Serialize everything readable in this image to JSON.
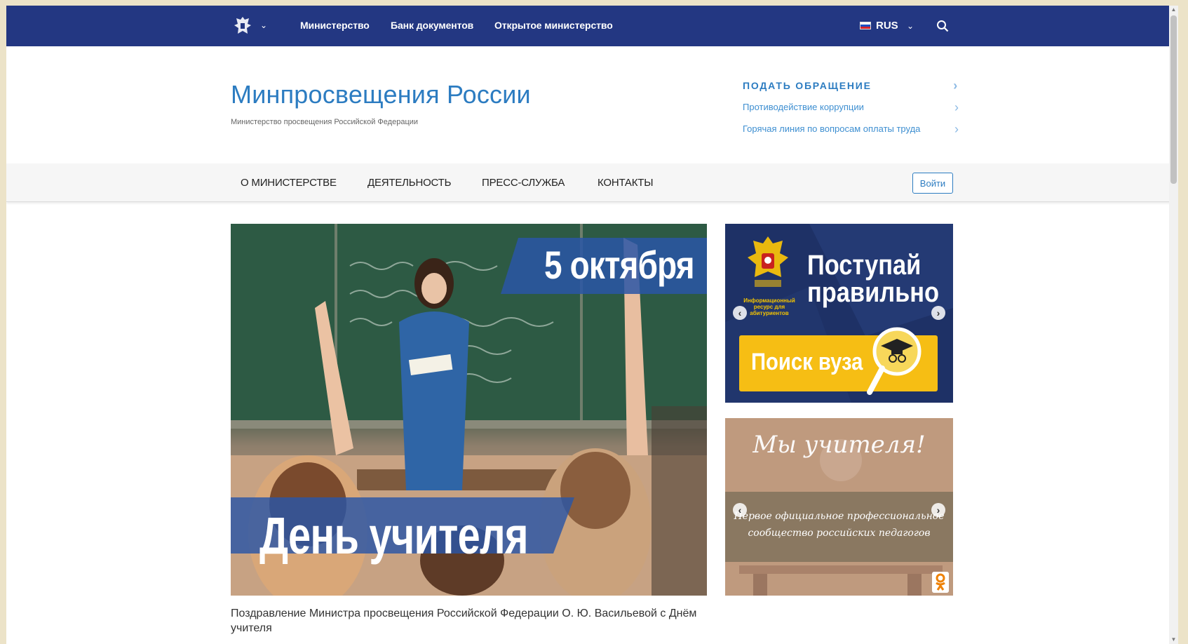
{
  "topbar": {
    "links": [
      "Министерство",
      "Банк документов",
      "Открытое министерство"
    ],
    "language": "RUS"
  },
  "header": {
    "title": "Минпросвещения России",
    "subtitle": "Министерство просвещения Российской Федерации",
    "side_links": [
      "ПОДАТЬ ОБРАЩЕНИЕ",
      "Противодействие коррупции",
      "Горячая линия по вопросам оплаты труда"
    ]
  },
  "mainnav": {
    "items": [
      "О МИНИСТЕРСТВЕ",
      "ДЕЯТЕЛЬНОСТЬ",
      "ПРЕСС-СЛУЖБА",
      "КОНТАКТЫ"
    ],
    "login": "Войти"
  },
  "hero": {
    "date": "5 октября",
    "title": "День учителя",
    "caption": "Поздравление Министра просвещения Российской Федерации О. Ю. Васильевой с Днём учителя"
  },
  "banners": {
    "first": {
      "title_line1": "Поступай",
      "title_line2": "правильно",
      "small_text": "Информационный ресурс для абитуриентов",
      "button": "Поиск вуза"
    },
    "second": {
      "title": "Мы учителя!",
      "text_line1": "Первое официальное профессиональное",
      "text_line2": "сообщество российских педагогов"
    }
  },
  "colors": {
    "topbar": "#233782",
    "accent": "#2c7cc1",
    "yellow": "#f6be14"
  }
}
